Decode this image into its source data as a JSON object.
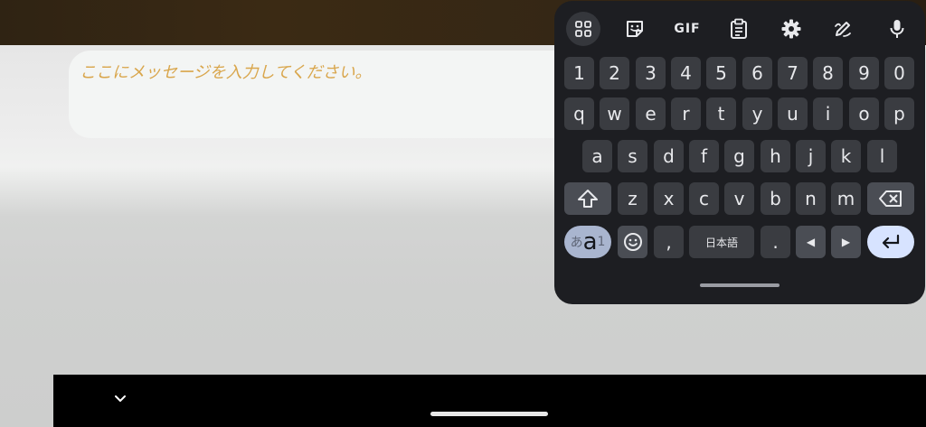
{
  "app": {
    "message_placeholder": "ここにメッセージを入力してください。"
  },
  "keyboard": {
    "toolbar": [
      {
        "name": "apps-grid-icon",
        "icon": "grid"
      },
      {
        "name": "sticker-icon",
        "icon": "sticker"
      },
      {
        "name": "gif-icon",
        "label": "GIF"
      },
      {
        "name": "clipboard-icon",
        "icon": "clipboard"
      },
      {
        "name": "settings-gear-icon",
        "icon": "gear"
      },
      {
        "name": "handwriting-pen-icon",
        "icon": "pen"
      },
      {
        "name": "microphone-icon",
        "icon": "mic"
      }
    ],
    "rows": {
      "numbers": [
        "1",
        "2",
        "3",
        "4",
        "5",
        "6",
        "7",
        "8",
        "9",
        "0"
      ],
      "row1": [
        "q",
        "w",
        "e",
        "r",
        "t",
        "y",
        "u",
        "i",
        "o",
        "p"
      ],
      "row2": [
        "a",
        "s",
        "d",
        "f",
        "g",
        "h",
        "j",
        "k",
        "l"
      ],
      "row3": [
        "z",
        "x",
        "c",
        "v",
        "b",
        "n",
        "m"
      ]
    },
    "bottom": {
      "lang_kana": "あ",
      "lang_latin": "a",
      "lang_num": "1",
      "comma": ",",
      "space_label": "日本語",
      "period": ".",
      "left_arrow": "◀",
      "right_arrow": "▶"
    },
    "colors": {
      "background": "#1d1e22",
      "key": "#3a3c41",
      "function_key": "#4a4d54",
      "enter_key": "#d7e3ff",
      "placeholder_text": "#d9a64c"
    }
  }
}
